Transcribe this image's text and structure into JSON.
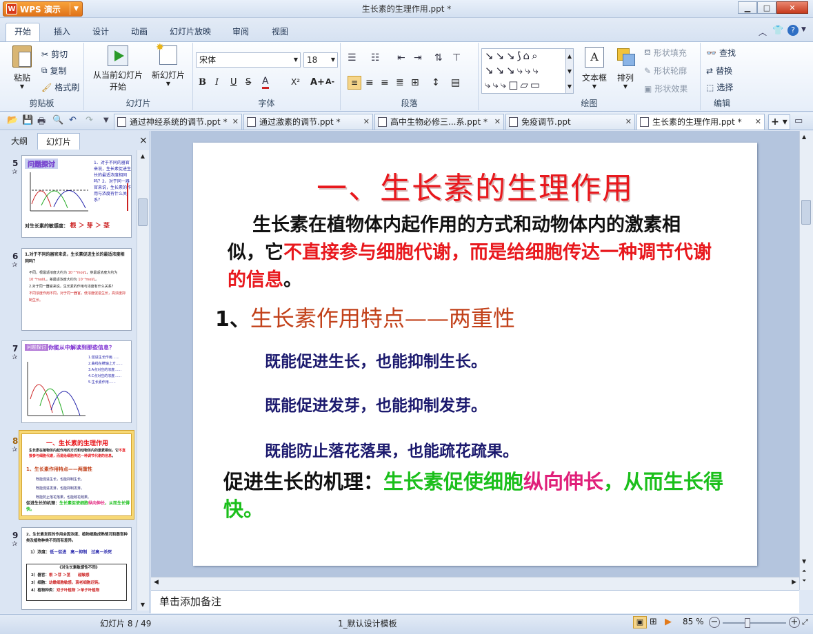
{
  "app": {
    "name": "WPS 演示",
    "doc_title": "生长素的生理作用.ppt *"
  },
  "ribbon_tabs": [
    "开始",
    "插入",
    "设计",
    "动画",
    "幻灯片放映",
    "审阅",
    "视图"
  ],
  "ribbon": {
    "clipboard": {
      "paste": "粘贴",
      "cut": "剪切",
      "copy": "复制",
      "format_painter": "格式刷",
      "label": "剪贴板"
    },
    "slides": {
      "from_current_line1": "从当前幻灯片",
      "from_current_line2": "开始",
      "new_slide": "新幻灯片",
      "label": "幻灯片"
    },
    "font": {
      "name": "宋体",
      "size": "18",
      "label": "字体",
      "bold": "B",
      "italic": "I",
      "underline": "U",
      "strike": "S",
      "color": "A",
      "superscript": "X²",
      "grow": "A+",
      "shrink": "A-"
    },
    "paragraph": {
      "label": "段落"
    },
    "drawing": {
      "textbox": "文本框",
      "arrange": "排列",
      "shape_fill": "形状填充",
      "shape_outline": "形状轮廓",
      "shape_effect": "形状效果",
      "label": "绘图"
    },
    "editing": {
      "find": "查找",
      "replace": "替换",
      "select": "选择",
      "label": "编辑"
    }
  },
  "doc_tabs": [
    {
      "label": "通过神经系统的调节.ppt *"
    },
    {
      "label": "通过激素的调节.ppt *"
    },
    {
      "label": "高中生物必修三...系.ppt *"
    },
    {
      "label": "免疫调节.ppt"
    },
    {
      "label": "生长素的生理作用.ppt *"
    }
  ],
  "panel_tabs": {
    "outline": "大纲",
    "slides": "幻灯片",
    "close": "×"
  },
  "thumbnails": [
    {
      "num": "5",
      "title": "问题探讨"
    },
    {
      "num": "6",
      "title": "1.对于不同的器官来说，生长素促进生长的最适浓度相同吗？"
    },
    {
      "num": "7",
      "title": "你能从中解读到那些信息？"
    },
    {
      "num": "8",
      "title": "一、生长素的生理作用"
    },
    {
      "num": "9",
      "title": "2、生长素发挥的作用会因浓度、植物细胞成熟情况和器官种类及植物种类不同而有差异。"
    }
  ],
  "slide": {
    "title": "一、生长素的生理作用",
    "intro_black": "生长素在植物体内起作用的方式和动物体内的激素相似，它",
    "intro_red": "不直接参与细胞代谢，而是给细胞传达一种调节代谢的信息",
    "intro_end": "。",
    "heading_num": "1",
    "heading_sep": "、",
    "heading": "生长素作用特点——两重性",
    "points": [
      "既能促进生长，也能抑制生长。",
      "既能促进发芽，也能抑制发芽。",
      "既能防止落花落果，也能疏花疏果。"
    ],
    "mech_label": "促进生长的机理：",
    "mech_green1": "生长素促使细胞",
    "mech_mag": "纵向伸长",
    "mech_green2": "，从而生长得快。"
  },
  "notes_placeholder": "单击添加备注",
  "status": {
    "slide_counter": "幻灯片 8 / 49",
    "template": "1_默认设计模板",
    "zoom": "85 %"
  },
  "colors": {
    "title_red": "#e8181d",
    "heading_orange": "#c2411a",
    "points_navy": "#1c1a6e",
    "green": "#1bbf1b",
    "magenta": "#e0207a"
  }
}
